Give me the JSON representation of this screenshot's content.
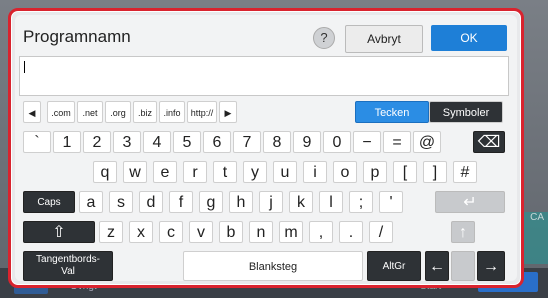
{
  "background": {
    "right_label": "CA",
    "left_label": "Övrigt",
    "start_label": "Start",
    "start_button": "Start"
  },
  "dialog": {
    "title": "Programnamn",
    "help": "?",
    "cancel_label": "Avbryt",
    "ok_label": "OK",
    "input_value": ""
  },
  "toolbar": {
    "left_arrow": "◀",
    "domains": [
      ".com",
      ".net",
      ".org",
      ".biz",
      ".info",
      "http://"
    ],
    "right_arrow": "▶",
    "tecken_label": "Tecken",
    "symboler_label": "Symboler"
  },
  "rows": {
    "r1": [
      "`",
      "1",
      "2",
      "3",
      "4",
      "5",
      "6",
      "7",
      "8",
      "9",
      "0",
      "−",
      "=",
      "@"
    ],
    "r2": [
      "q",
      "w",
      "e",
      "r",
      "t",
      "y",
      "u",
      "i",
      "o",
      "p",
      "[",
      "]",
      "#"
    ],
    "r3": [
      "a",
      "s",
      "d",
      "f",
      "g",
      "h",
      "j",
      "k",
      "l",
      ";",
      "'"
    ],
    "r4": [
      "z",
      "x",
      "c",
      "v",
      "b",
      "n",
      "m",
      ",",
      ".",
      "/"
    ]
  },
  "keys": {
    "backspace": "⌫",
    "caps": "Caps",
    "enter": "↵",
    "shift": "⇧",
    "tangent": "Tangentbords-\nVal",
    "space": "Blanksteg",
    "altgr": "AltGr",
    "left": "←",
    "up": "↑",
    "right": "→"
  },
  "colors": {
    "accent": "#d9232e",
    "primary": "#1e7fd7",
    "dark_key": "#2e3236"
  }
}
